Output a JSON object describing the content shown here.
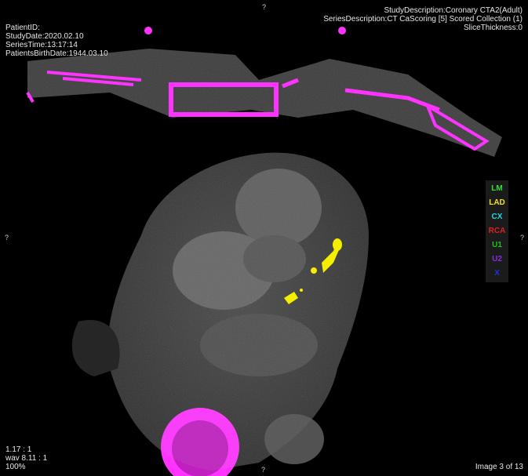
{
  "overlay": {
    "top_left": [
      "PatientID:",
      "StudyDate:2020.02.10",
      "SeriesTime:13:17:14",
      "PatientsBirthDate:1944.03.10"
    ],
    "top_right": [
      "StudyDescription:Coronary CTA2(Adult)",
      "SeriesDescription:CT CaScoring [5] Scored Collection (1)",
      "SliceThickness:0"
    ],
    "bottom_left": [
      "1.17 : 1",
      "wav 8.11 : 1",
      "100%"
    ],
    "bottom_right": "Image 3 of 13",
    "orientation": {
      "top": "?",
      "left": "?",
      "right": "?",
      "bottom": "?"
    }
  },
  "legend": [
    {
      "label": "LM",
      "color": "#33e033"
    },
    {
      "label": "LAD",
      "color": "#f0e020"
    },
    {
      "label": "CX",
      "color": "#20d8e8"
    },
    {
      "label": "RCA",
      "color": "#e02020"
    },
    {
      "label": "U1",
      "color": "#20c020"
    },
    {
      "label": "U2",
      "color": "#8a2be2"
    },
    {
      "label": "X",
      "color": "#2030e0"
    }
  ],
  "colors": {
    "calcium_overlay": "#ff33ff",
    "lad_lesion": "#f5ee00"
  }
}
